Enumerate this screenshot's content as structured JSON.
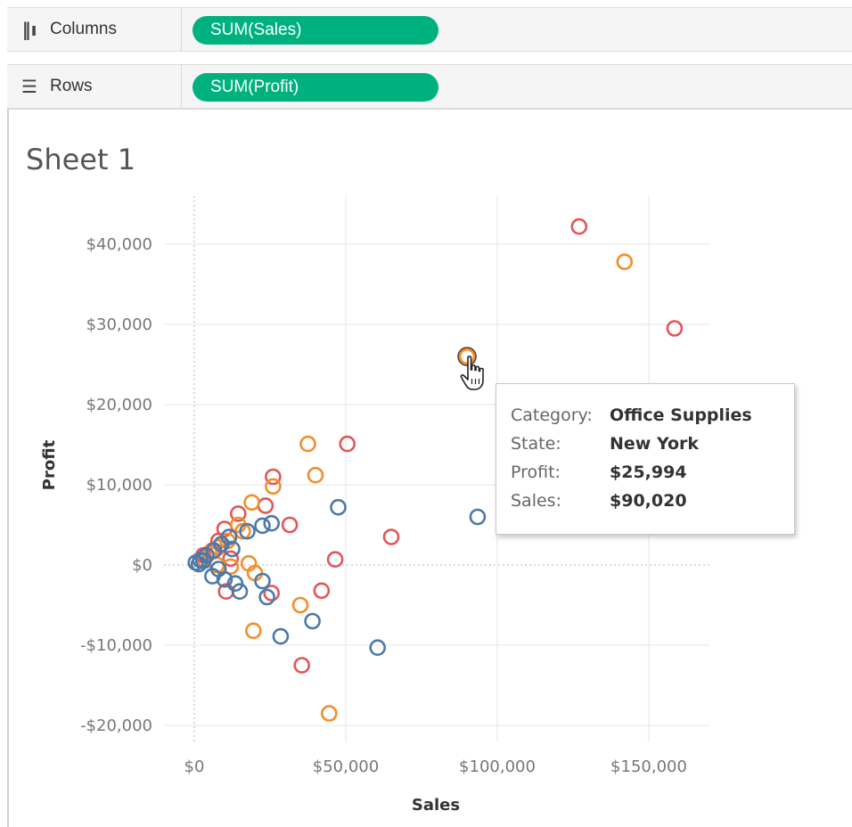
{
  "shelves": {
    "columns": {
      "label": "Columns",
      "pill": "SUM(Sales)",
      "icon": "columns-icon"
    },
    "rows": {
      "label": "Rows",
      "pill": "SUM(Profit)",
      "icon": "rows-icon"
    }
  },
  "sheet": {
    "title": "Sheet 1"
  },
  "colors": {
    "pill": "#00b180",
    "furniture": "#f28e2b",
    "office_supplies": "#f28e2b",
    "technology": "#e15759",
    "blue_series": "#4e79a7",
    "grid": "#e6e6e6"
  },
  "tooltip": {
    "rows": [
      {
        "key": "Category:",
        "value": "Office Supplies"
      },
      {
        "key": "State:",
        "value": "New York"
      },
      {
        "key": "Profit:",
        "value": "$25,994"
      },
      {
        "key": "Sales:",
        "value": "$90,020"
      }
    ]
  },
  "chart_data": {
    "type": "scatter",
    "title": "Sheet 1",
    "xlabel": "Sales",
    "ylabel": "Profit",
    "xlim": [
      -10000,
      170000
    ],
    "ylim": [
      -22000,
      46000
    ],
    "x_ticks": [
      0,
      50000,
      100000,
      150000
    ],
    "x_tick_labels": [
      "$0",
      "$50,000",
      "$100,000",
      "$150,000"
    ],
    "y_ticks": [
      -20000,
      -10000,
      0,
      10000,
      20000,
      30000,
      40000
    ],
    "y_tick_labels": [
      "-$20,000",
      "-$10,000",
      "$0",
      "$10,000",
      "$20,000",
      "$30,000",
      "$40,000"
    ],
    "grid": true,
    "zero_lines": true,
    "series": [
      {
        "color": "#e15759",
        "points": [
          [
            127000,
            42200
          ],
          [
            158500,
            29500
          ],
          [
            50500,
            15100
          ],
          [
            26000,
            11000
          ],
          [
            23500,
            7400
          ],
          [
            31500,
            5000
          ],
          [
            14500,
            6400
          ],
          [
            10000,
            4500
          ],
          [
            65000,
            3500
          ],
          [
            46500,
            700
          ],
          [
            42000,
            -3200
          ],
          [
            25500,
            -3500
          ],
          [
            10500,
            -3300
          ],
          [
            35500,
            -12500
          ],
          [
            12000,
            800
          ],
          [
            6000,
            1800
          ],
          [
            3000,
            1200
          ],
          [
            8000,
            3000
          ]
        ]
      },
      {
        "color": "#f28e2b",
        "points": [
          [
            142000,
            37800
          ],
          [
            90000,
            26000
          ],
          [
            37500,
            15100
          ],
          [
            40000,
            11200
          ],
          [
            26000,
            9800
          ],
          [
            19000,
            7800
          ],
          [
            14500,
            5000
          ],
          [
            16000,
            4200
          ],
          [
            11000,
            3000
          ],
          [
            8000,
            2200
          ],
          [
            5000,
            1500
          ],
          [
            3000,
            800
          ],
          [
            18000,
            200
          ],
          [
            20000,
            -1000
          ],
          [
            35000,
            -5000
          ],
          [
            19500,
            -8200
          ],
          [
            44500,
            -18500
          ],
          [
            7500,
            0
          ],
          [
            12000,
            -200
          ]
        ]
      },
      {
        "color": "#4e79a7",
        "points": [
          [
            93500,
            6000
          ],
          [
            47500,
            7200
          ],
          [
            25500,
            5200
          ],
          [
            22500,
            4900
          ],
          [
            17500,
            4200
          ],
          [
            11500,
            3500
          ],
          [
            9000,
            2600
          ],
          [
            6500,
            1800
          ],
          [
            4000,
            1200
          ],
          [
            2000,
            600
          ],
          [
            500,
            300
          ],
          [
            1500,
            100
          ],
          [
            3000,
            500
          ],
          [
            6000,
            -1400
          ],
          [
            10000,
            -1800
          ],
          [
            13500,
            -2300
          ],
          [
            15000,
            -3300
          ],
          [
            22500,
            -2000
          ],
          [
            24000,
            -4000
          ],
          [
            28500,
            -8900
          ],
          [
            39000,
            -7000
          ],
          [
            60500,
            -10300
          ],
          [
            8000,
            -500
          ],
          [
            12500,
            2000
          ]
        ]
      }
    ],
    "highlight": {
      "x": 90020,
      "y": 25994
    }
  }
}
